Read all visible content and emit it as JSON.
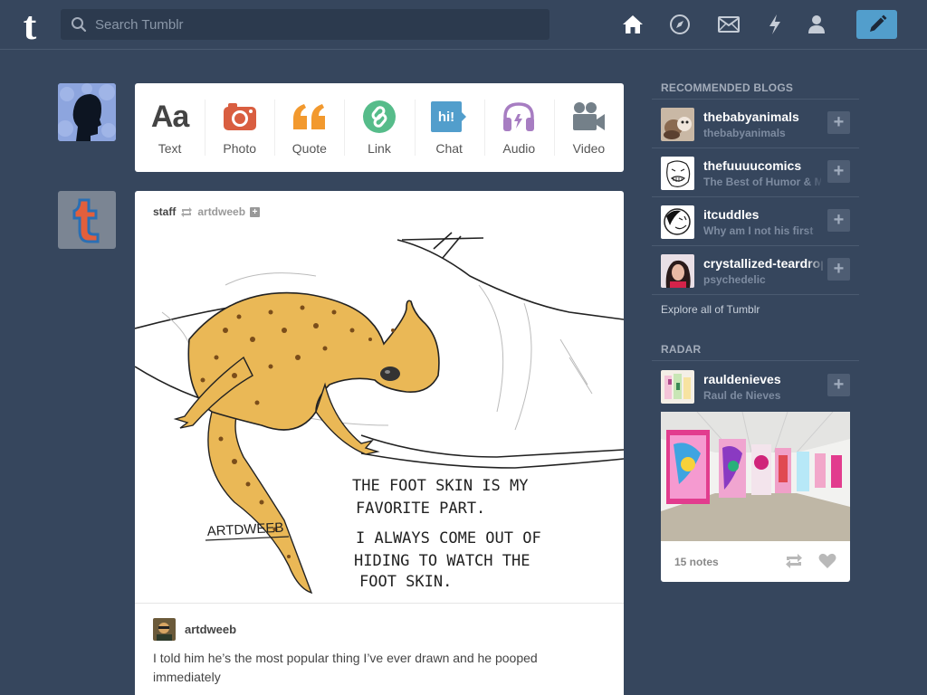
{
  "header": {
    "logo_letter": "t",
    "search_placeholder": "Search Tumblr",
    "nav_icons": [
      "home-icon",
      "explore-compass-icon",
      "inbox-envelope-icon",
      "activity-lightning-icon",
      "account-person-icon",
      "compose-pencil-icon"
    ],
    "accent_color": "#529ecc",
    "background_color": "#36465d"
  },
  "post_types": [
    {
      "label": "Text",
      "icon": "Aa",
      "color": "#444444"
    },
    {
      "label": "Photo",
      "icon": "camera-icon",
      "color": "#d95e40"
    },
    {
      "label": "Quote",
      "icon": "quote-icon",
      "color": "#f2992e"
    },
    {
      "label": "Link",
      "icon": "link-icon",
      "color": "#56bc8a"
    },
    {
      "label": "Chat",
      "icon": "hi!",
      "color": "#529ecc"
    },
    {
      "label": "Audio",
      "icon": "headphones-icon",
      "color": "#a77dc2"
    },
    {
      "label": "Video",
      "icon": "video-camera-icon",
      "color": "#748089"
    }
  ],
  "post": {
    "poster": "staff",
    "reblogged_from": "artdweeb",
    "artwork": {
      "signature": "ARTDWEEB",
      "text_lines": [
        "THE FOOT SKIN IS MY",
        "FAVORITE PART.",
        "I ALWAYS COME OUT OF",
        "HIDING TO WATCH THE",
        "FOOT SKIN."
      ]
    },
    "caption_user": "artdweeb",
    "caption": "I told him he’s the most popular thing I’ve ever drawn and he pooped immediately"
  },
  "sidebar": {
    "recommended_title": "RECOMMENDED BLOGS",
    "recommended": [
      {
        "name": "thebabyanimals",
        "subtitle": "thebabyanimals"
      },
      {
        "name": "thefuuuucomics",
        "subtitle": "The Best of Humor & Memes"
      },
      {
        "name": "itcuddles",
        "subtitle": "Why am I not his first"
      },
      {
        "name": "crystallized-teardrops",
        "subtitle": "psychedelic"
      }
    ],
    "explore_label": "Explore all of Tumblr",
    "radar_title": "RADAR",
    "radar": {
      "name": "rauldenieves",
      "subtitle": "Raul de Nieves",
      "notes": "15 notes"
    }
  }
}
